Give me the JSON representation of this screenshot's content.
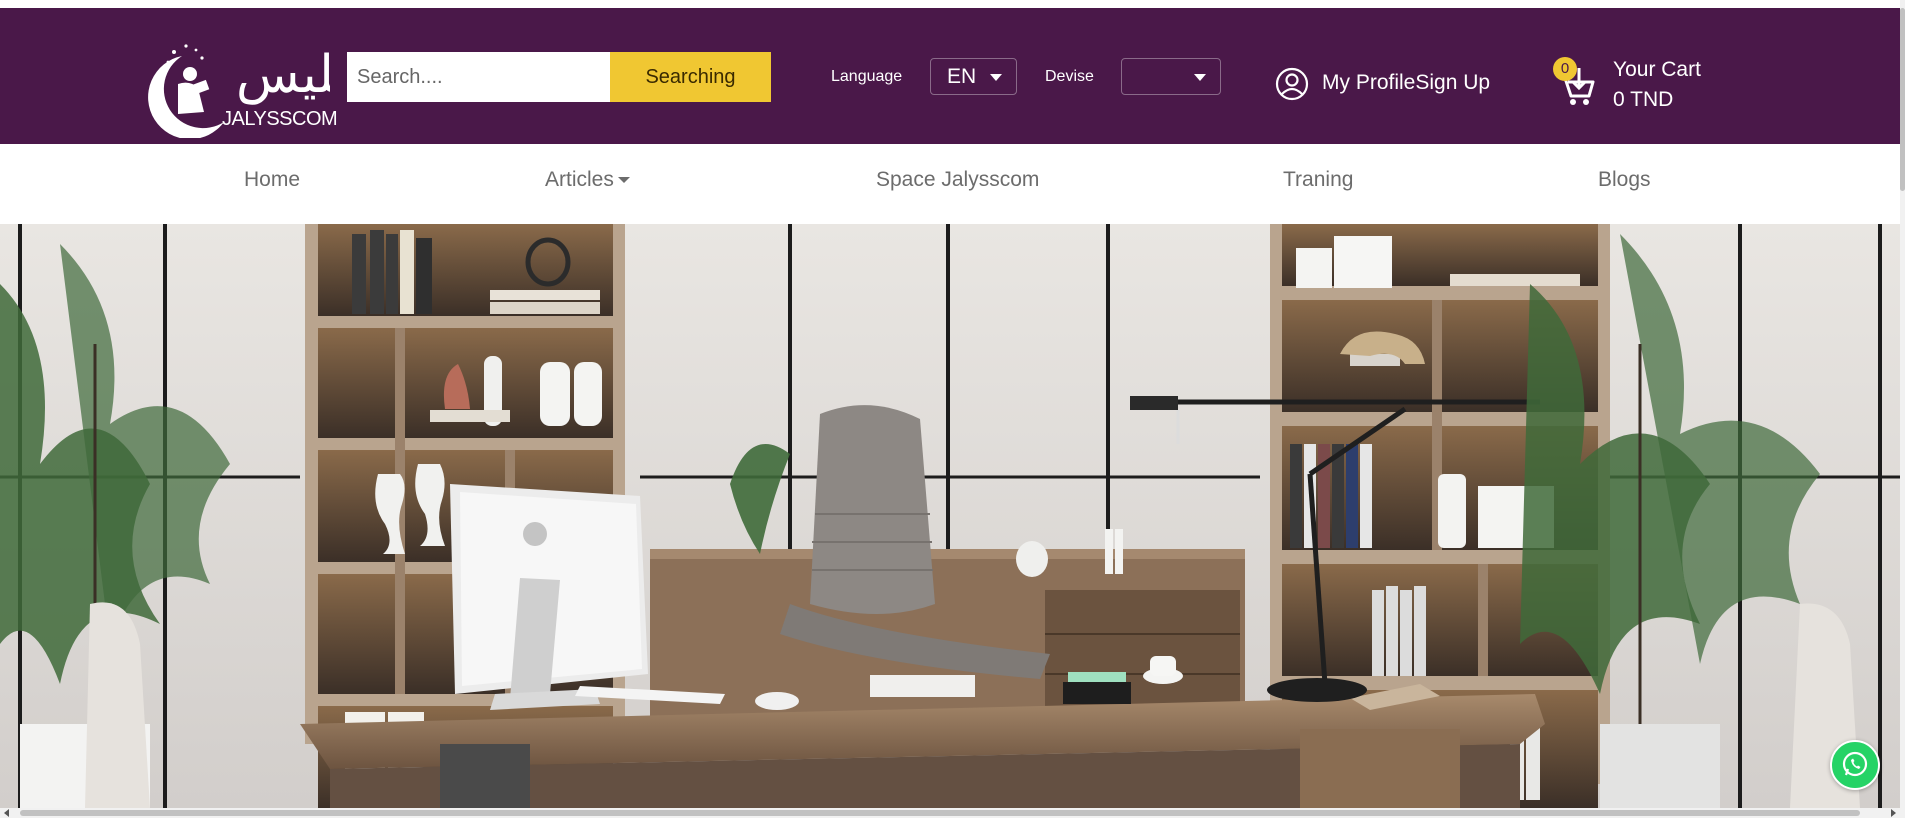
{
  "header": {
    "logo_text": "JALYSSCOM",
    "logo_arabic": "جليس",
    "search": {
      "placeholder": "Search....",
      "button_label": "Searching"
    },
    "language": {
      "label": "Language",
      "value": "EN"
    },
    "devise": {
      "label": "Devise",
      "value": ""
    },
    "profile": {
      "label": "My ProfileSign Up",
      "icon": "user-circle-icon"
    },
    "cart": {
      "count": "0",
      "title": "Your Cart",
      "total": "0 TND",
      "icon": "cart-icon"
    }
  },
  "nav": {
    "items": [
      {
        "label": "Home"
      },
      {
        "label": "Articles",
        "has_dropdown": true
      },
      {
        "label": "Space Jalysscom"
      },
      {
        "label": "Traning"
      },
      {
        "label": "Blogs"
      }
    ]
  },
  "hero": {
    "description": "office interior photo banner"
  },
  "floating": {
    "icon": "whatsapp-icon"
  },
  "colors": {
    "header_bg": "#4a1849",
    "accent": "#f0c732",
    "nav_text": "#6c6c6c",
    "whatsapp": "#25d366"
  }
}
